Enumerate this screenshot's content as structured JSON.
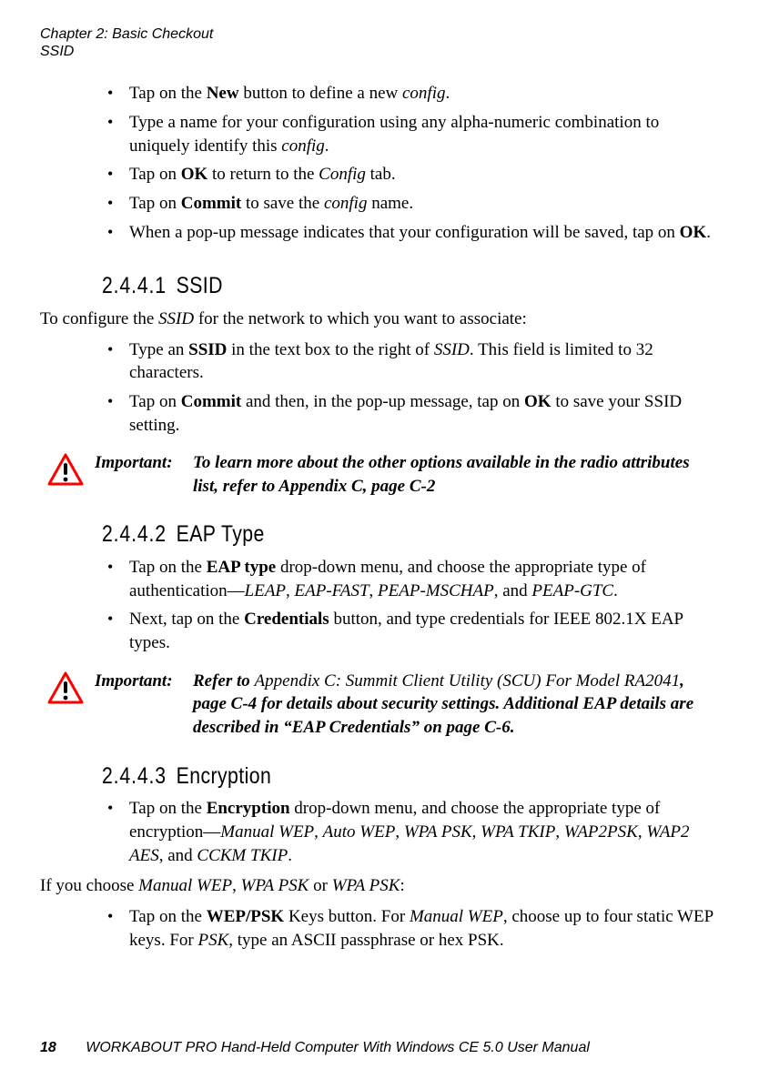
{
  "header": {
    "chapter": "Chapter  2:  Basic Checkout",
    "section": "SSID"
  },
  "intro_list": [
    "Tap on the <b>New</b> button to define a new <i>config</i>.",
    "Type a name for your configuration using any alpha-numeric combination to uniquely identify this <i>config</i>.",
    "Tap on <b>OK</b> to return to the <i>Config</i> tab.",
    "Tap on <b>Commit</b> to save the <i>config</i> name.",
    "When a pop-up message indicates that your configuration will be saved, tap on <b>OK</b>."
  ],
  "s2441": {
    "num": "2.4.4.1",
    "title": "SSID",
    "para": "To configure the <i>SSID</i> for the network to which you want to associate:",
    "list": [
      "Type an <b>SSID</b> in the text box to the right of <i>SSID</i>. This field is limited to 32 characters.",
      "Tap on <b>Commit</b> and then, in the pop-up message, tap on <b>OK</b> to save your SSID setting."
    ]
  },
  "note1": {
    "label": "Important:",
    "text": "To learn more about the other options available in the radio attributes list, refer to Appendix C, page C-2"
  },
  "s2442": {
    "num": "2.4.4.2",
    "title": "EAP Type",
    "list": [
      "Tap on the <b>EAP type</b> drop-down menu, and choose the appropriate type of authentication—<i>LEAP</i>, <i>EAP-FAST</i>, <i>PEAP-MSCHAP</i>, and <i>PEAP-GTC</i>.",
      "Next, tap on the <b>Credentials</b> button, and type credentials for IEEE 802.1X EAP types."
    ]
  },
  "note2": {
    "label": "Important:",
    "text": "Refer to <span class=\"plain\"><i>Appendix C: Summit Client Utility (SCU) For Model RA2041</i></span>, page C-4 for details about security settings. Additional EAP details are described in “EAP Credentials” on page C-6."
  },
  "s2443": {
    "num": "2.4.4.3",
    "title": "Encryption",
    "list": [
      "Tap on the <b>Encryption</b> drop-down menu, and choose the appropriate type of encryption—<i>Manual WEP</i>, <i>Auto WEP</i>, <i>WPA PSK</i>, <i>WPA TKIP</i>, <i>WAP2PSK</i>, <i>WAP2 AES</i>, and <i>CCKM TKIP</i>."
    ],
    "para": "If you choose <i>Manual WEP</i>, <i>WPA PSK</i> or <i>WPA PSK</i>:",
    "list2": [
      "Tap on the <b>WEP/PSK</b> Keys button. For <i>Manual WEP</i>, choose up to four static WEP keys. For <i>PSK</i>, type an ASCII passphrase or hex PSK."
    ]
  },
  "footer": {
    "page": "18",
    "text": "WORKABOUT PRO Hand-Held Computer With Windows CE 5.0 User Manual"
  }
}
